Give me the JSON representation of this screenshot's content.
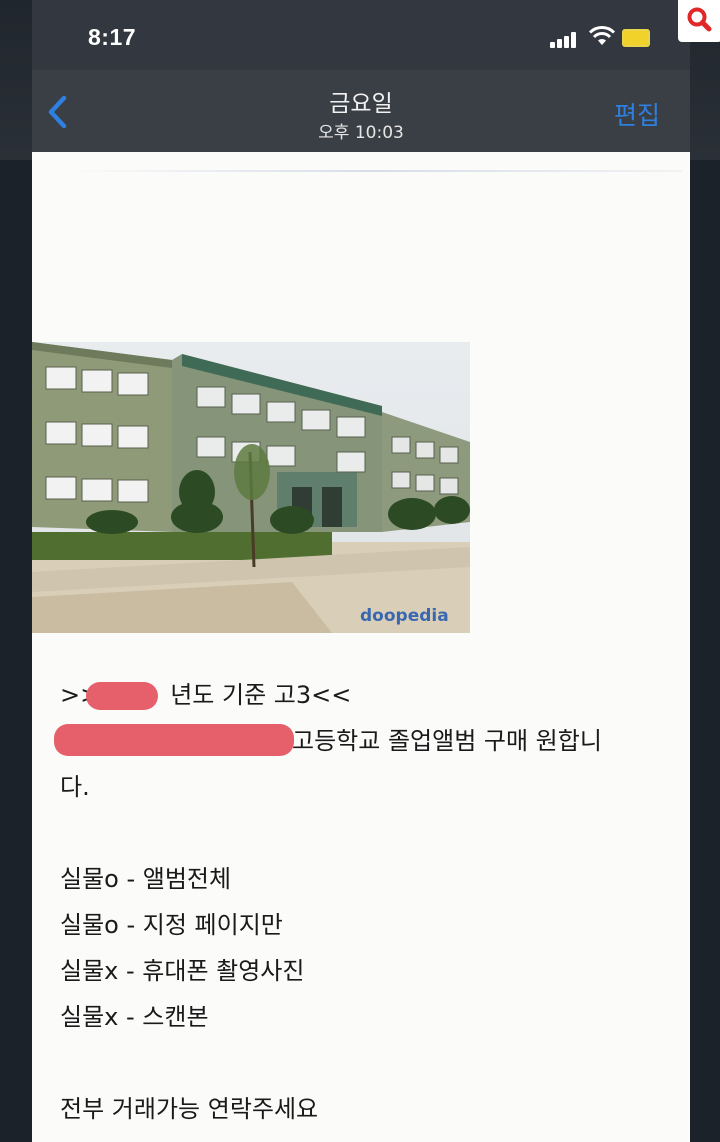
{
  "status_bar": {
    "time": "8:17",
    "icons": [
      "cellular-signal-icon",
      "wifi-icon",
      "battery-icon",
      "search-icon"
    ]
  },
  "nav": {
    "title": "금요일",
    "subtitle": "오후 10:03",
    "edit_label": "편집",
    "accent_color": "#2f7fe0"
  },
  "image": {
    "watermark": "doopedia"
  },
  "message": {
    "line1_prefix": ">>",
    "line1_suffix": "년도 기준 고3<<",
    "line2_suffix": "고등학교 졸업앨범 구매 원합니",
    "line3": "다.",
    "options": [
      "실물o - 앨범전체",
      "실물o - 지정 페이지만",
      "실물x - 휴대폰 촬영사진",
      "실물x - 스캔본"
    ],
    "closing": "전부 거래가능 연락주세요"
  },
  "redaction_color": "#e5606a"
}
